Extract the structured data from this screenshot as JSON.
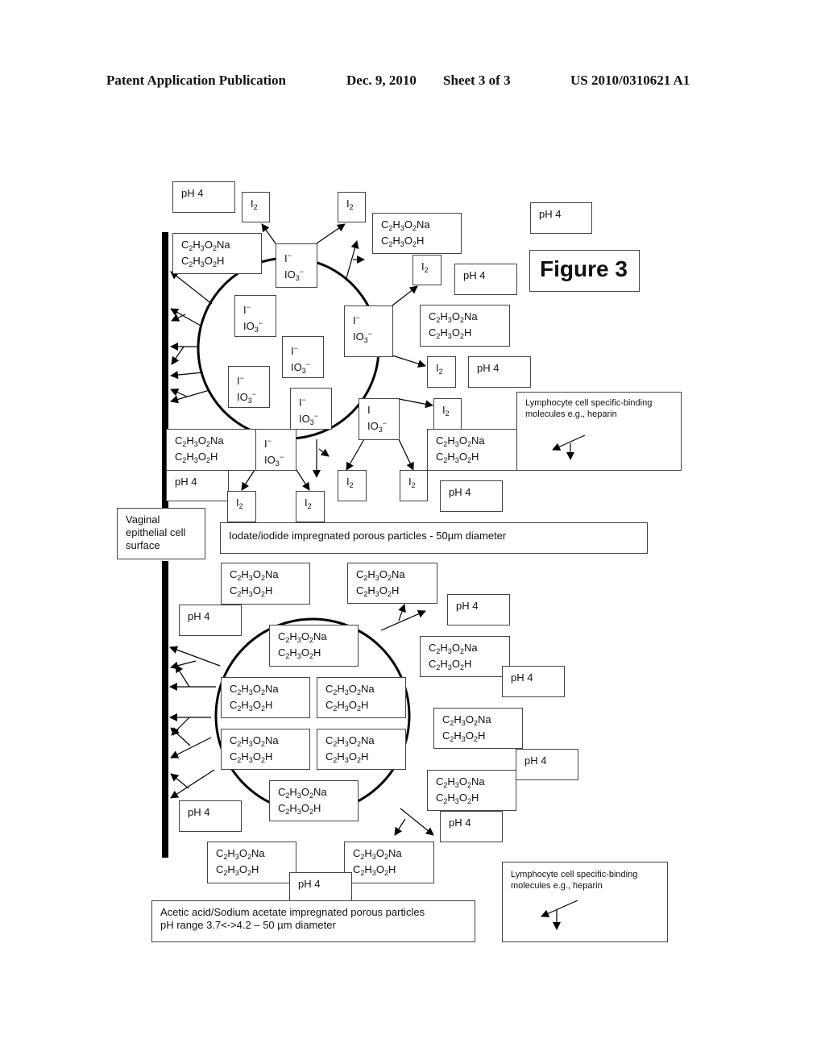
{
  "header": {
    "publication": "Patent Application Publication",
    "date": "Dec. 9, 2010",
    "sheet": "Sheet 3 of 3",
    "number": "US 2010/0310621 A1"
  },
  "figure_title": "Figure 3",
  "labels": {
    "ph": "pH 4",
    "acetate_line1": "C2H3O2Na",
    "acetate_line2": "C2H3O2H",
    "iodine": "I2",
    "iodide": "I−",
    "iodate": "IO3−",
    "iodide_alt": "I",
    "vaginal_surface": [
      "Vaginal",
      "epithelial cell",
      "surface"
    ],
    "iodate_particles": "Iodate/iodide impregnated porous particles - 50µm diameter",
    "acetate_particles": [
      "Acetic acid/Sodium acetate impregnated porous particles",
      "pH range 3.7<->4.2 – 50 µm diameter"
    ],
    "lymphocyte_legend": [
      "Lymphocyte cell specific-binding",
      "molecules e.g., heparin"
    ]
  },
  "icons": {
    "arrow": "arrow-icon",
    "binding_molecule": "binding-molecule-icon"
  }
}
